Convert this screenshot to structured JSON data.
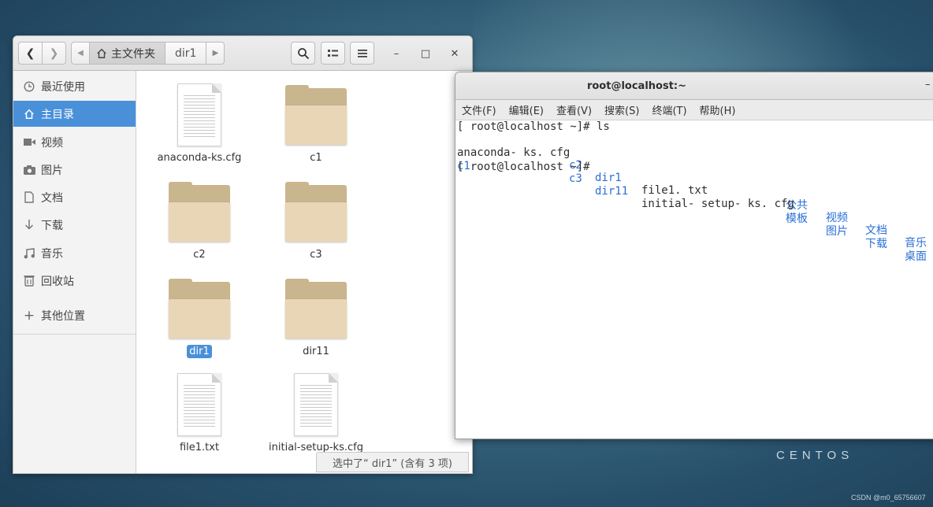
{
  "file_manager": {
    "path": {
      "home_label": "主文件夹",
      "current_dir": "dir1"
    },
    "window_controls": {
      "minimize": "–",
      "maximize": "□",
      "close": "✕"
    },
    "sidebar": {
      "items": [
        {
          "label": "最近使用",
          "icon": "clock-icon"
        },
        {
          "label": "主目录",
          "icon": "home-icon",
          "active": true
        },
        {
          "label": "视频",
          "icon": "video-icon"
        },
        {
          "label": "图片",
          "icon": "camera-icon"
        },
        {
          "label": "文档",
          "icon": "document-icon"
        },
        {
          "label": "下载",
          "icon": "download-icon"
        },
        {
          "label": "音乐",
          "icon": "music-icon"
        },
        {
          "label": "回收站",
          "icon": "trash-icon"
        },
        {
          "label": "其他位置",
          "icon": "plus-icon"
        }
      ]
    },
    "files": [
      {
        "name": "anaconda-ks.cfg",
        "type": "document"
      },
      {
        "name": "c1",
        "type": "folder"
      },
      {
        "name": "c2",
        "type": "folder"
      },
      {
        "name": "c3",
        "type": "folder"
      },
      {
        "name": "dir1",
        "type": "folder",
        "selected": true
      },
      {
        "name": "dir11",
        "type": "folder"
      },
      {
        "name": "file1.txt",
        "type": "document"
      },
      {
        "name": "initial-setup-ks.cfg",
        "type": "document"
      }
    ],
    "status": "选中了“ dir1” (含有 3 项)"
  },
  "terminal": {
    "title": "root@localhost:~",
    "menu": [
      "文件(F)",
      "编辑(E)",
      "查看(V)",
      "搜索(S)",
      "终端(T)",
      "帮助(H)"
    ],
    "line1": "[ root@localhost ~]# ls",
    "listing": {
      "row1": [
        "anaconda- ks. cfg",
        "c2",
        "dir1",
        "file1. txt",
        "公共",
        "视频",
        "文档",
        "音乐"
      ],
      "row2": [
        "c1",
        "c3",
        "dir11",
        "initial- setup- ks. cfg",
        "模板",
        "图片",
        "下载",
        "桌面"
      ]
    },
    "prompt": "[ root@localhost ~]#"
  },
  "desktop": {
    "logo": "CENTOS",
    "watermark": "CSDN @m0_65756607"
  },
  "colors": {
    "accent": "#4a90d9",
    "terminal_dir": "#2a6fd6"
  }
}
